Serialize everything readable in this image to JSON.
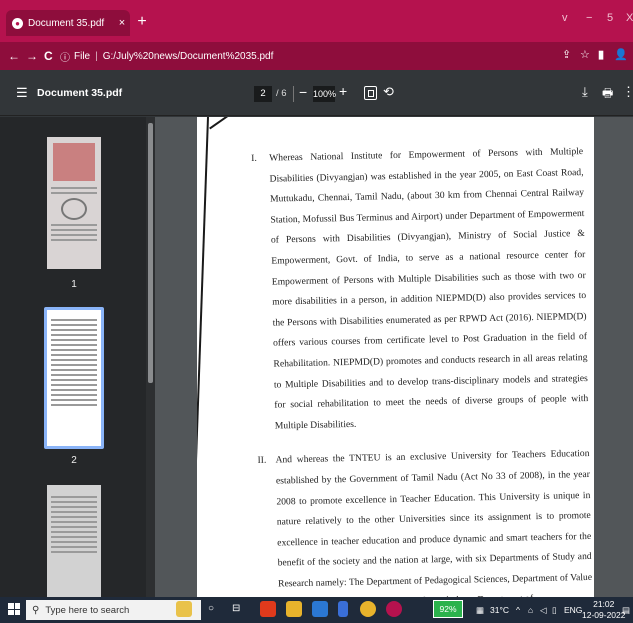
{
  "browser": {
    "tab_title": "Document 35.pdf",
    "tab_close": "×",
    "new_tab": "+",
    "window_controls": [
      "v",
      "−",
      "5",
      "X"
    ],
    "back": "←",
    "forward": "→",
    "reload": "C",
    "file_label": "File",
    "url": "G:/July%20news/Document%2035.pdf",
    "share_icon": "share-icon",
    "bookmark_star": "☆"
  },
  "pdf_toolbar": {
    "menu_icon": "☰",
    "doc_name": "Document 35.pdf",
    "current_page": "2",
    "total_pages": "/ 6",
    "zoom_minus": "−",
    "zoom_value": "100%",
    "zoom_plus": "+",
    "download_icon": "⤓",
    "print_icon": "🖶",
    "more_icon": "⋮",
    "rotate_icon": "⟲"
  },
  "sidebar": {
    "thumbnails": [
      {
        "label": "1"
      },
      {
        "label": "2"
      }
    ]
  },
  "document": {
    "paragraphs": [
      {
        "number": "I.",
        "text": "Whereas National Institute for Empowerment of Persons with Multiple Disabilities (Divyangjan) was established in the year 2005, on East Coast Road, Muttukadu, Chennai, Tamil Nadu, (about 30 km from Chennai Central Railway Station, Mofussil Bus Terminus and Airport) under Department of Empowerment of Persons with Disabilities (Divyangjan), Ministry of Social Justice & Empowerment, Govt. of India, to serve as a national resource center for Empowerment of Persons with Multiple Disabilities such as those with two or more disabilities in a person, in addition NIEPMD(D) also provides services to the Persons with Disabilities enumerated as per RPWD Act (2016). NIEPMD(D) offers various courses from certificate level to Post Graduation in the field of Rehabilitation. NIEPMD(D) promotes and conducts research in all areas relating to Multiple Disabilities and to develop trans-disciplinary models and strategies for social rehabilitation to meet the needs of diverse groups of people with Multiple Disabilities."
      },
      {
        "number": "II.",
        "text": "And whereas the TNTEU is an exclusive University for Teachers Education established by the Government of Tamil Nadu (Act No 33 of 2008), in the year 2008 to promote excellence in Teacher Education. This University is unique in nature relatively to the other Universities since its assignment is to promote excellence in teacher education and produce dynamic and smart teachers for the benefit of the society and the nation at large, with six Departments of Study and Research namely: The Department of Pedagogical Sciences, Department of Value Education, Department of Educational Psychology, Department of"
      }
    ]
  },
  "taskbar": {
    "search_placeholder": "Type here to search",
    "battery": "92%",
    "temperature": "31°C",
    "language": "ENG",
    "time": "21:02",
    "date": "12-09-2022"
  },
  "colors": {
    "browser_accent": "#b5124e",
    "browser_accent_dark": "#8e0d3c",
    "viewer_bg": "#525659",
    "toolbar_bg": "#323639",
    "thumb_selected": "#8ab4f8"
  }
}
